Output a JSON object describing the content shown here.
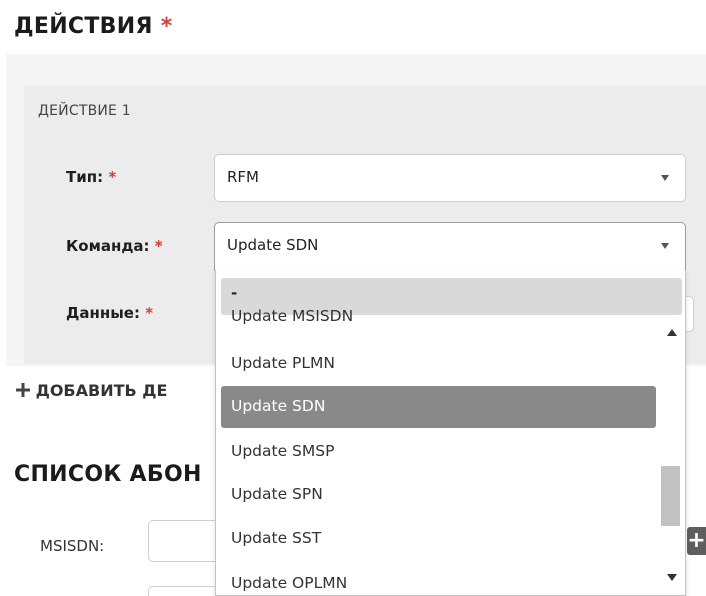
{
  "actions_section": {
    "title": "ДЕЙСТВИЯ",
    "required_mark": "*"
  },
  "action_block": {
    "title": "ДЕЙСТВИЕ 1"
  },
  "fields": {
    "type": {
      "label": "Тип:",
      "required_mark": "*",
      "value": "RFM"
    },
    "command": {
      "label": "Команда:",
      "required_mark": "*",
      "value": "Update SDN"
    },
    "data": {
      "label": "Данные:",
      "required_mark": "*"
    }
  },
  "add_action": {
    "icon": "plus-icon",
    "label": "ДОБАВИТЬ ДЕ"
  },
  "subscribers_section": {
    "title": "СПИСОК АБОН"
  },
  "msisdn": {
    "label": "MSISDN:",
    "add_button_icon": "plus-icon"
  },
  "command_dropdown": {
    "first_option": "-",
    "options": [
      "Update MSISDN",
      "Update PLMN",
      "Update SDN",
      "Update SMSP",
      "Update SPN",
      "Update SST",
      "Update OPLMN"
    ],
    "selected": "Update SDN"
  },
  "colors": {
    "required": "#e23a2e",
    "selected_option_bg": "#898989",
    "hover_option_bg": "#d9d9d9",
    "panel_bg": "#ececec"
  }
}
